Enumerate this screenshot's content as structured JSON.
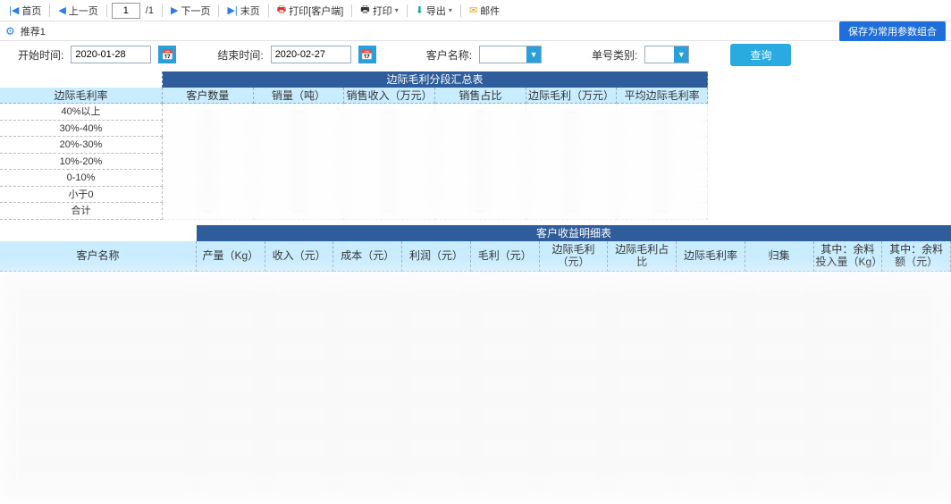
{
  "toolbar": {
    "first_page": "首页",
    "prev_page": "上一页",
    "page_current": "1",
    "page_total": "/1",
    "next_page": "下一页",
    "last_page": "末页",
    "print_client": "打印[客户端]",
    "print": "打印",
    "export": "导出",
    "mail": "邮件"
  },
  "tabs": {
    "recommend1": "推荐1",
    "save_params": "保存为常用参数组合"
  },
  "filter": {
    "start_label": "开始时间:",
    "start_value": "2020-01-28",
    "end_label": "结束时间:",
    "end_value": "2020-02-27",
    "customer_label": "客户名称:",
    "customer_value": "",
    "order_type_label": "单号类别:",
    "order_type_value": "",
    "query": "查询"
  },
  "summary": {
    "title": "边际毛利分段汇总表",
    "left_header": "边际毛利率",
    "rows": [
      "40%以上",
      "30%-40%",
      "20%-30%",
      "10%-20%",
      "0-10%",
      "小于0",
      "合计"
    ],
    "cols": [
      "客户数量",
      "销量（吨）",
      "销售收入（万元）",
      "销售占比",
      "边际毛利（万元）",
      "平均边际毛利率"
    ]
  },
  "detail": {
    "title": "客户收益明细表",
    "cols": [
      "客户名称",
      "产量（Kg）",
      "收入（元）",
      "成本（元）",
      "利润（元）",
      "毛利（元）",
      "边际毛利（元）",
      "边际毛利占比",
      "边际毛利率",
      "归集",
      "其中：余料投入量（Kg）",
      "其中：余料额（元）"
    ]
  },
  "icons": {
    "arrow_first": "|◀",
    "arrow_prev": "◀",
    "arrow_next": "▶",
    "arrow_last": "▶|",
    "calendar": "📅",
    "dropdown": "▼",
    "filter": "⚙",
    "print": "🖶",
    "export": "⬇",
    "mail": "✉"
  },
  "colors": {
    "accent": "#29abe2",
    "header_blue": "#2f5c9a",
    "sub_header": "#c9ecff"
  }
}
